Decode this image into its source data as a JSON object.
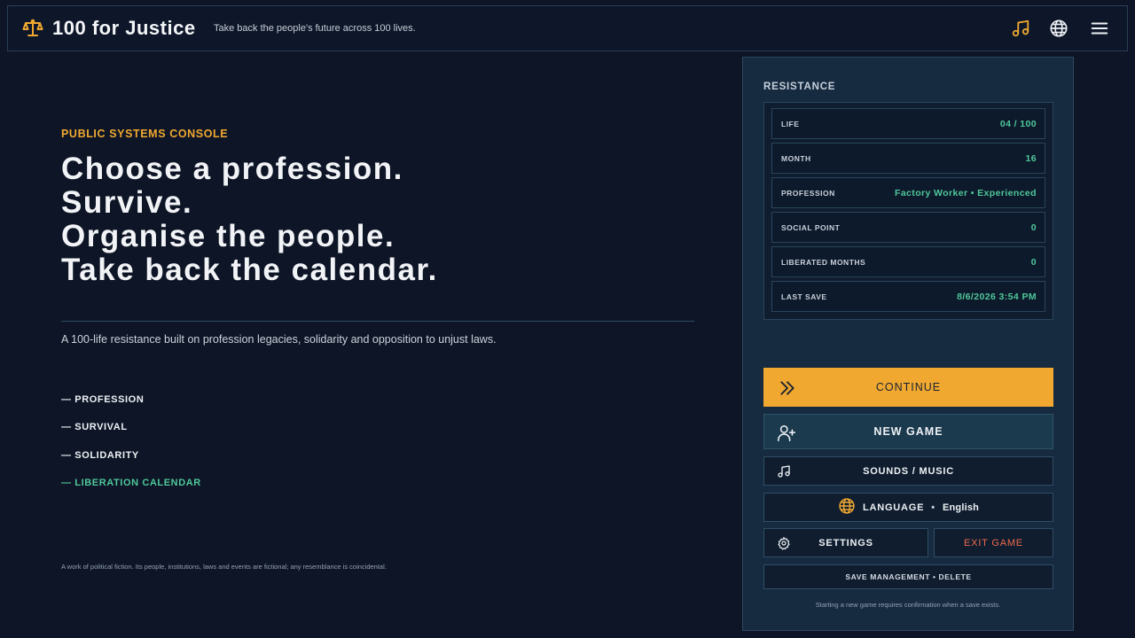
{
  "header": {
    "title": "100 for Justice",
    "tagline": "Take back the people's future across 100 lives.",
    "icons": [
      "scales-icon",
      "music-note-icon",
      "globe-icon",
      "hamburger-menu-icon"
    ]
  },
  "hero": {
    "kicker": "PUBLIC SYSTEMS CONSOLE",
    "headline": [
      "Choose a profession.",
      "Survive.",
      "Organise the people.",
      "Take back the calendar."
    ],
    "lede": "A 100-life resistance built on profession legacies, solidarity and opposition to unjust laws.",
    "pillars": [
      {
        "label": "— PROFESSION",
        "active": false
      },
      {
        "label": "— SURVIVAL",
        "active": false
      },
      {
        "label": "— SOLIDARITY",
        "active": false
      },
      {
        "label": "— LIBERATION CALENDAR",
        "active": true
      }
    ],
    "disclaimer": "A work of political fiction. Its people, institutions, laws and events are fictional; any resemblance is coincidental."
  },
  "panel": {
    "title": "RESISTANCE",
    "stats": [
      {
        "label": "LIFE",
        "value": "04 / 100"
      },
      {
        "label": "MONTH",
        "value": "16"
      },
      {
        "label": "PROFESSION",
        "value": "Factory Worker • Experienced"
      },
      {
        "label": "SOCIAL POINT",
        "value": "0"
      },
      {
        "label": "LIBERATED MONTHS",
        "value": "0"
      },
      {
        "label": "LAST SAVE",
        "value": "8/6/2026 3:54 PM"
      }
    ],
    "buttons": {
      "continue": "CONTINUE",
      "new_game": "NEW GAME",
      "sounds": "SOUNDS / MUSIC",
      "language_label": "LANGUAGE",
      "language_sep": "•",
      "language_value": "English",
      "settings": "SETTINGS",
      "exit": "EXIT GAME",
      "save_management": "SAVE MANAGEMENT • DELETE"
    },
    "note": "Starting a new game requires confirmation when a save exists."
  },
  "colors": {
    "background": "#0d1526",
    "accent": "#f0a830",
    "success": "#4fc79a",
    "danger": "#ee6a4c",
    "panel": "#162a40"
  }
}
